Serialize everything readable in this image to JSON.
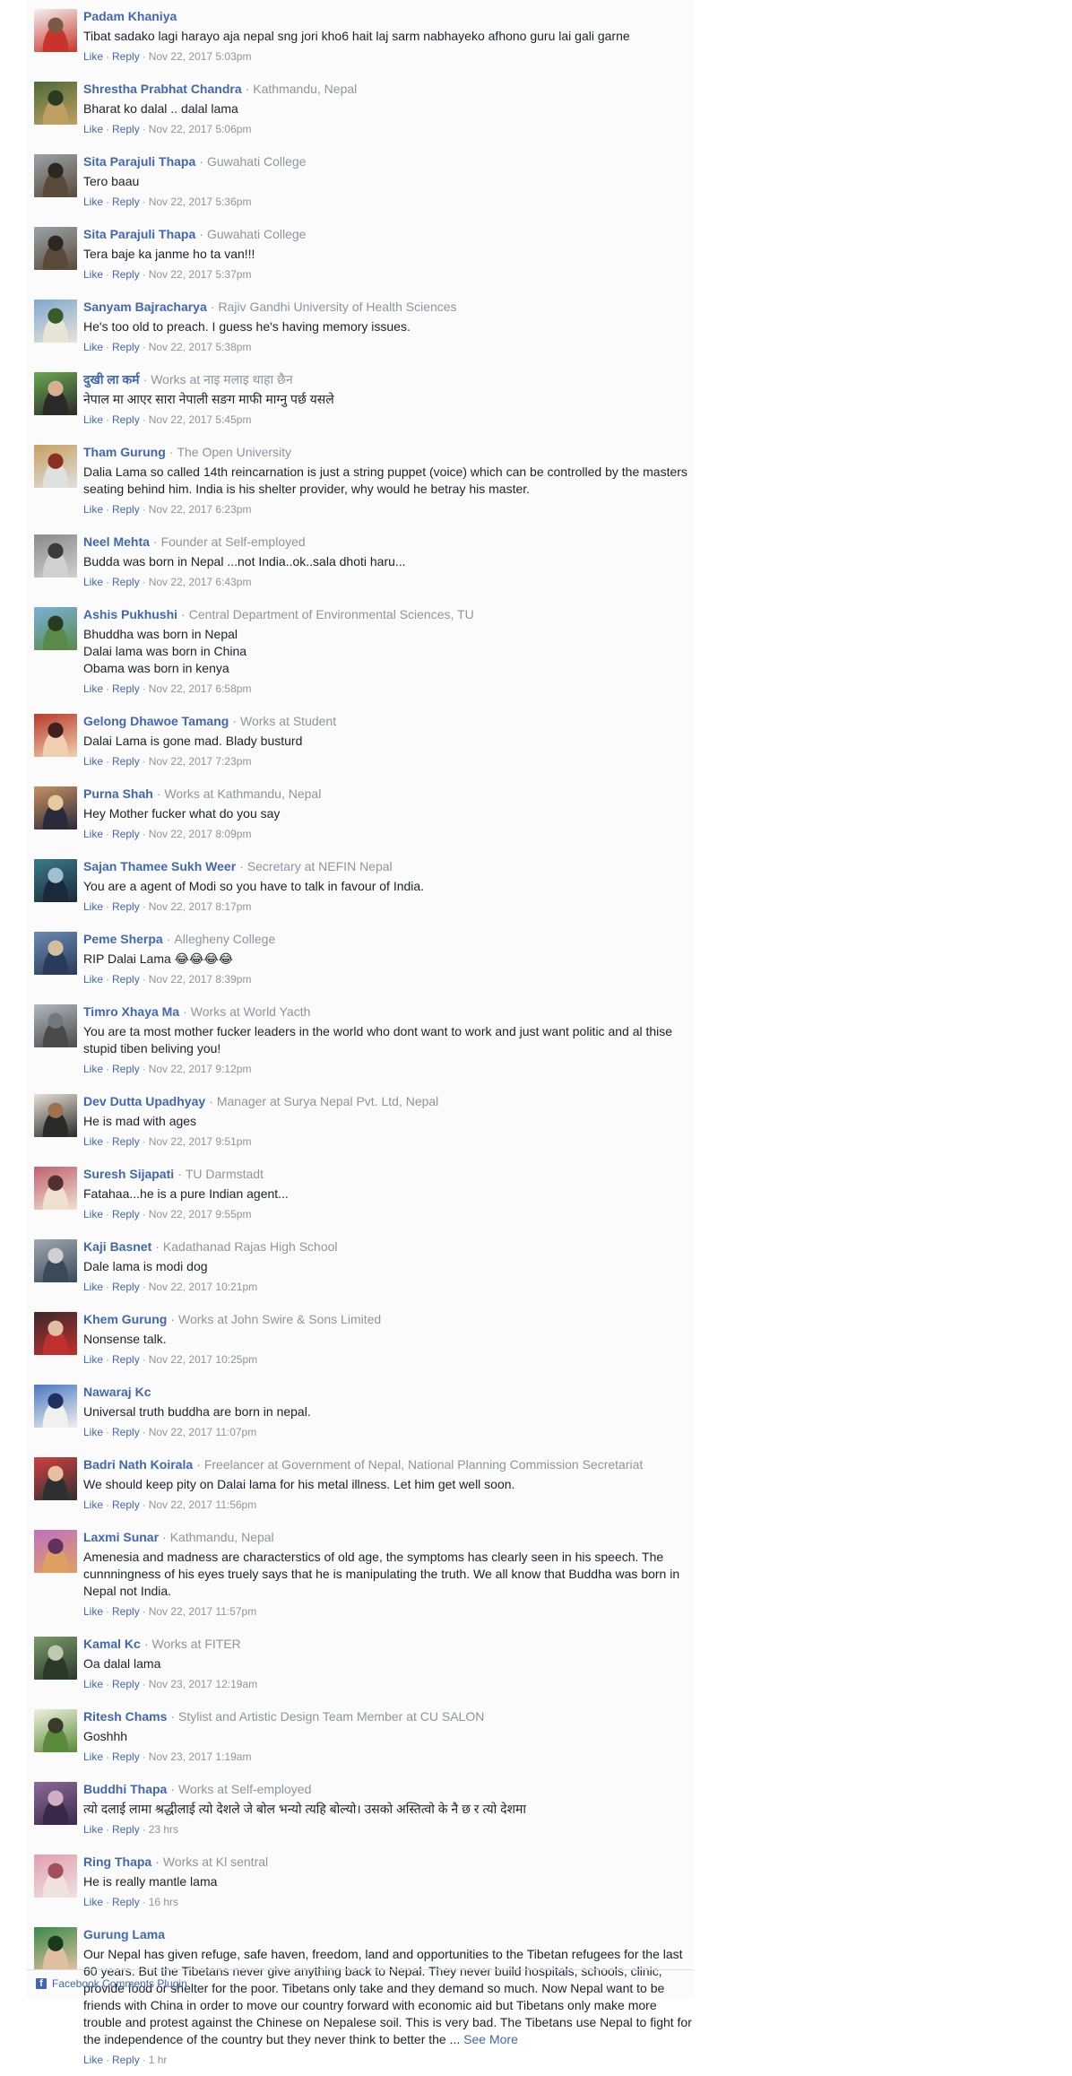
{
  "actions": {
    "like": "Like",
    "reply": "Reply",
    "dot": "·"
  },
  "comments": [
    {
      "author": "Padam Khaniya",
      "meta": "",
      "text": "Tibat sadako lagi harayo aja nepal sng jori kho6 hait laj sarm nabhayeko afhono guru lai gali garne",
      "time": "Nov 22, 2017 5:03pm",
      "avatar_colors": [
        "#f2f2f2",
        "#c8342a",
        "#7a5a44"
      ]
    },
    {
      "author": "Shrestha Prabhat Chandra",
      "meta": "Kathmandu, Nepal",
      "text": "Bharat ko dalal .. dalal lama",
      "time": "Nov 22, 2017 5:06pm",
      "avatar_colors": [
        "#4e6a3a",
        "#c0a060",
        "#2d3b22"
      ]
    },
    {
      "author": "Sita Parajuli Thapa",
      "meta": "Guwahati College",
      "text": "Tero baau",
      "time": "Nov 22, 2017 5:36pm",
      "avatar_colors": [
        "#9aa3a8",
        "#5a4a3a",
        "#2e2620"
      ]
    },
    {
      "author": "Sita Parajuli Thapa",
      "meta": "Guwahati College",
      "text": "Tera baje ka janme ho ta van!!!",
      "time": "Nov 22, 2017 5:37pm",
      "avatar_colors": [
        "#9aa3a8",
        "#5a4a3a",
        "#2e2620"
      ]
    },
    {
      "author": "Sanyam Bajracharya",
      "meta": "Rajiv Gandhi University of Health Sciences",
      "text": "He's too old to preach. I guess he's having memory issues.",
      "time": "Nov 22, 2017 5:38pm",
      "avatar_colors": [
        "#7fa8d0",
        "#e8e4d8",
        "#3a5a2a"
      ]
    },
    {
      "author": "दुखी ला कर्म",
      "meta": "Works at नाइ मलाइ थाहा छैन",
      "text": "नेपाल मा आएर सारा नेपाली सङग माफी माग्नु पर्छ यसले",
      "time": "Nov 22, 2017 5:45pm",
      "avatar_colors": [
        "#6aa84f",
        "#2a2a2a",
        "#d8b090"
      ]
    },
    {
      "author": "Tham Gurung",
      "meta": "The Open University",
      "text": "Dalia Lama so called 14th reincarnation is just a string puppet (voice) which can be controlled by the masters seating behind him. India is his shelter provider, why would he betray his master.",
      "time": "Nov 22, 2017 6:23pm",
      "avatar_colors": [
        "#c8a060",
        "#e0e0e0",
        "#8a3020"
      ]
    },
    {
      "author": "Neel Mehta",
      "meta": "Founder at Self-employed",
      "text": "Budda was born in Nepal ...not India..ok..sala dhoti haru...",
      "time": "Nov 22, 2017 6:43pm",
      "avatar_colors": [
        "#8a8a8a",
        "#d0d0d0",
        "#3a3a3a"
      ]
    },
    {
      "author": "Ashis Pukhushi",
      "meta": "Central Department of Environmental Sciences, TU",
      "text": "Bhuddha was born in Nepal\nDalai lama was born in China\nObama was born in kenya",
      "time": "Nov 22, 2017 6:58pm",
      "avatar_colors": [
        "#7ab0d8",
        "#5a8a4a",
        "#2a3a20"
      ]
    },
    {
      "author": "Gelong Dhawoe Tamang",
      "meta": "Works at Student",
      "text": "Dalai Lama is gone mad. Blady busturd",
      "time": "Nov 22, 2017 7:23pm",
      "avatar_colors": [
        "#b83a2a",
        "#f0d0b0",
        "#402020"
      ]
    },
    {
      "author": "Purna Shah",
      "meta": "Works at Kathmandu, Nepal",
      "text": "Hey Mother fucker what do you say",
      "time": "Nov 22, 2017 8:09pm",
      "avatar_colors": [
        "#c89060",
        "#2a2a3a",
        "#e8c8a0"
      ]
    },
    {
      "author": "Sajan Thamee Sukh Weer",
      "meta": "Secretary at NEFIN Nepal",
      "text": "You are a agent of Modi so you have to talk in favour of India.",
      "time": "Nov 22, 2017 8:17pm",
      "avatar_colors": [
        "#3a7a8a",
        "#1a2a3a",
        "#a0c0d0"
      ]
    },
    {
      "author": "Peme Sherpa",
      "meta": "Allegheny College",
      "text": "RIP Dalai Lama 😂😂😂😂",
      "time": "Nov 22, 2017 8:39pm",
      "avatar_colors": [
        "#6a8ab0",
        "#2a3a5a",
        "#d0c0a0"
      ]
    },
    {
      "author": "Timro Xhaya Ma",
      "meta": "Works at World Yacth",
      "text": "You are ta most mother fucker leaders in the world who dont want to work and just want politic and al thise stupid tiben beliving you!",
      "time": "Nov 22, 2017 9:12pm",
      "avatar_colors": [
        "#b0b8c0",
        "#4a4a4a",
        "#707880"
      ]
    },
    {
      "author": "Dev Dutta Upadhyay",
      "meta": "Manager at Surya Nepal Pvt. Ltd, Nepal",
      "text": "He is mad with ages",
      "time": "Nov 22, 2017 9:51pm",
      "avatar_colors": [
        "#e8e0d8",
        "#2a2a2a",
        "#a07050"
      ]
    },
    {
      "author": "Suresh Sijapati",
      "meta": "TU Darmstadt",
      "text": "Fatahaa...he is a pure Indian agent...",
      "time": "Nov 22, 2017 9:55pm",
      "avatar_colors": [
        "#c06070",
        "#f0e0d0",
        "#503030"
      ]
    },
    {
      "author": "Kaji Basnet",
      "meta": "Kadathanad Rajas High School",
      "text": "Dale lama is modi dog",
      "time": "Nov 22, 2017 10:21pm",
      "avatar_colors": [
        "#a0a8b0",
        "#3a4a5a",
        "#d0d0d0"
      ]
    },
    {
      "author": "Khem Gurung",
      "meta": "Works at John Swire & Sons Limited",
      "text": "Nonsense talk.",
      "time": "Nov 22, 2017 10:25pm",
      "avatar_colors": [
        "#3a2a2a",
        "#c03030",
        "#e0c0a0"
      ]
    },
    {
      "author": "Nawaraj Kc",
      "meta": "",
      "text": "Universal truth buddha are born in nepal.",
      "time": "Nov 22, 2017 11:07pm",
      "avatar_colors": [
        "#4a78c0",
        "#f0f0f0",
        "#203060"
      ]
    },
    {
      "author": "Badri Nath Koirala",
      "meta": "Freelancer at Government of Nepal, National Planning Commission Secretariat",
      "text": "We should keep pity on Dalai lama for his metal illness. Let him get well soon.",
      "time": "Nov 22, 2017 11:56pm",
      "avatar_colors": [
        "#d04040",
        "#303030",
        "#e8c0a0"
      ]
    },
    {
      "author": "Laxmi Sunar",
      "meta": "Kathmandu, Nepal",
      "text": "Amenesia and madness are characterstics of old age, the symptoms has clearly seen in his speech. The cunnningness of his eyes truely says that he is manipulating the truth. We all know that Buddha was born in Nepal not India.",
      "time": "Nov 22, 2017 11:57pm",
      "avatar_colors": [
        "#c070c0",
        "#e0a060",
        "#603060"
      ]
    },
    {
      "author": "Kamal Kc",
      "meta": "Works at FITER",
      "text": "Oa dalal lama",
      "time": "Nov 23, 2017 12:19am",
      "avatar_colors": [
        "#7a9a6a",
        "#2a3a2a",
        "#c0c8b0"
      ]
    },
    {
      "author": "Ritesh Chams",
      "meta": "Stylist and Artistic Design Team Member at CU SALON",
      "text": "Goshhh",
      "time": "Nov 23, 2017 1:19am",
      "avatar_colors": [
        "#f0f0e0",
        "#5a8a3a",
        "#3a3a2a"
      ]
    },
    {
      "author": "Buddhi Thapa",
      "meta": "Works at Self-employed",
      "text": "त्यो दलाई लामा श्रद्धीलाई त्यो देशले जे बोल भन्यो त्यहि बोल्यो। उसको अस्तित्वो के नै छ र त्यो देशमा",
      "time": "23 hrs",
      "avatar_colors": [
        "#8a6a9a",
        "#3a2a4a",
        "#d0b0c0"
      ]
    },
    {
      "author": "Ring Thapa",
      "meta": "Works at Kl sentral",
      "text": "He is really mantle lama",
      "time": "16 hrs",
      "avatar_colors": [
        "#e0a0b0",
        "#f0e0e0",
        "#a05060"
      ]
    },
    {
      "author": "Gurung Lama",
      "meta": "",
      "text": "Our Nepal has given refuge, safe haven, freedom, land and opportunities to the Tibetan refugees for the last 60 years. But the Tibetans never give anything back to Nepal. They never build hospitals, schools, clinic, provide food or shelter for the poor. Tibetans only take and they demand so much. Now Nepal want to be friends with China in order to move our country forward with economic aid but Tibetans only make more trouble and protest against the Chinese on Nepalese soil. This is very bad. The Tibetans use Nepal to fight for the independence of the country but they never think to better the ... ",
      "see_more": "See More",
      "time": "1 hr",
      "avatar_colors": [
        "#3a8a4a",
        "#e0c0a0",
        "#1a3a20"
      ]
    }
  ],
  "footer": {
    "icon": "f",
    "label": "Facebook Comments Plugin"
  }
}
